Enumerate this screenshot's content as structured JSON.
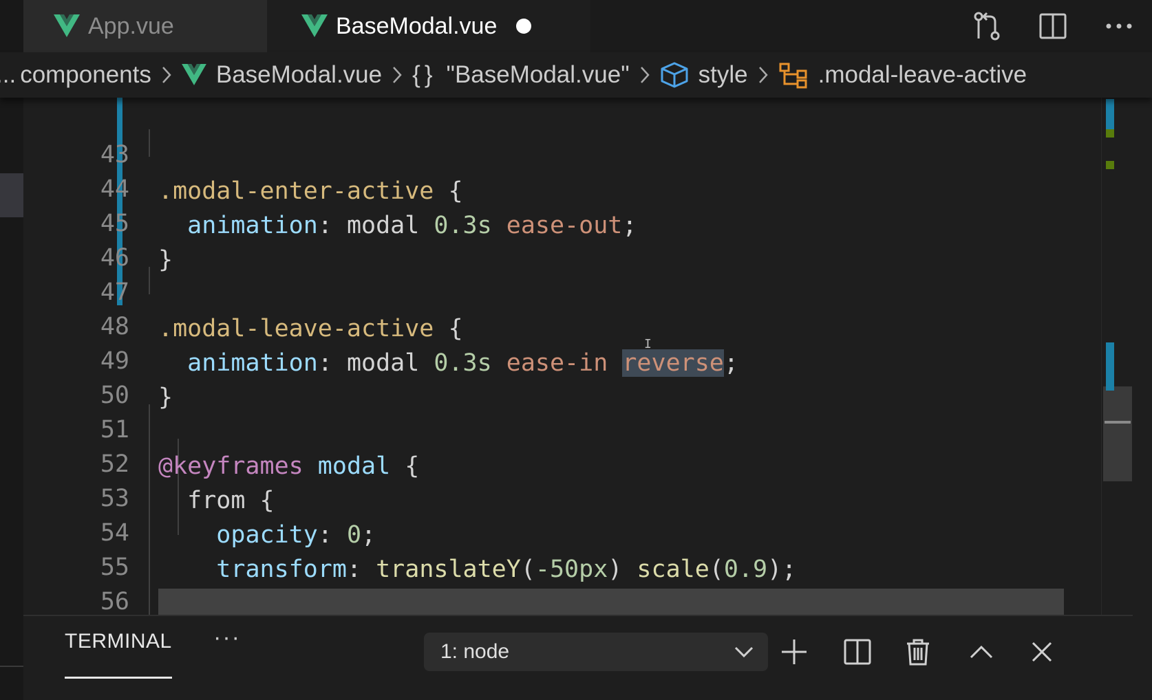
{
  "tabs": [
    {
      "label": "App.vue",
      "active": false
    },
    {
      "label": "BaseModal.vue",
      "active": true,
      "modified": true
    }
  ],
  "tab_actions": [
    "source-control-icon",
    "split-editor-icon",
    "more-icon"
  ],
  "breadcrumb": {
    "ellipsis": "...",
    "folder": "components",
    "file": "BaseModal.vue",
    "scope_braces": "{}",
    "scope": "\"BaseModal.vue\"",
    "section": "style",
    "selector": ".modal-leave-active"
  },
  "editor": {
    "lines": [
      {
        "n": "43",
        "text": ".modal-enter-active {"
      },
      {
        "n": "44",
        "text": "  animation: modal 0.3s ease-out;"
      },
      {
        "n": "45",
        "text": "}"
      },
      {
        "n": "46",
        "text": ""
      },
      {
        "n": "47",
        "text": ".modal-leave-active {"
      },
      {
        "n": "48",
        "text": "  animation: modal 0.3s ease-in reverse;"
      },
      {
        "n": "49",
        "text": "}"
      },
      {
        "n": "50",
        "text": ""
      },
      {
        "n": "51",
        "text": "@keyframes modal {"
      },
      {
        "n": "52",
        "text": "  from {"
      },
      {
        "n": "53",
        "text": "    opacity: 0;"
      },
      {
        "n": "54",
        "text": "    transform: translateY(-50px) scale(0.9);"
      },
      {
        "n": "55",
        "text": "  }"
      },
      {
        "n": "56",
        "text": ""
      }
    ],
    "highlighted_word": "reverse"
  },
  "panel": {
    "tab_label": "TERMINAL",
    "more": "···",
    "terminal_select": "1: node",
    "actions": [
      "new-terminal-icon",
      "split-terminal-icon",
      "kill-terminal-icon",
      "maximize-panel-icon",
      "close-panel-icon"
    ]
  },
  "colors": {
    "background": "#1e1e1e",
    "selector": "#d7ba7d",
    "property": "#9cdcfe",
    "number": "#b5cea8",
    "keyword_value": "#ce9178",
    "at_rule": "#c586c0",
    "function": "#dcdcaa",
    "modified_gutter": "#1b81a8",
    "vue_green": "#41b883"
  }
}
